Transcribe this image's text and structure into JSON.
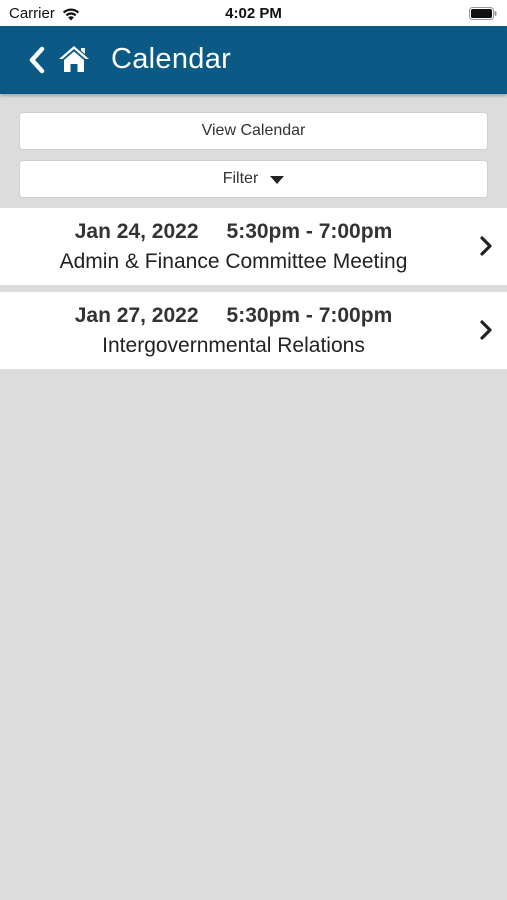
{
  "status_bar": {
    "carrier": "Carrier",
    "time": "4:02 PM"
  },
  "nav": {
    "title": "Calendar",
    "back_icon": "chevron-left-icon",
    "home_icon": "home-icon",
    "background_color": "#0b5a86"
  },
  "buttons": {
    "view_calendar": "View Calendar",
    "filter": "Filter"
  },
  "events": [
    {
      "date": "Jan 24, 2022",
      "time": "5:30pm - 7:00pm",
      "title": "Admin & Finance Committee Meeting"
    },
    {
      "date": "Jan 27, 2022",
      "time": "5:30pm - 7:00pm",
      "title": "Intergovernmental Relations"
    }
  ]
}
